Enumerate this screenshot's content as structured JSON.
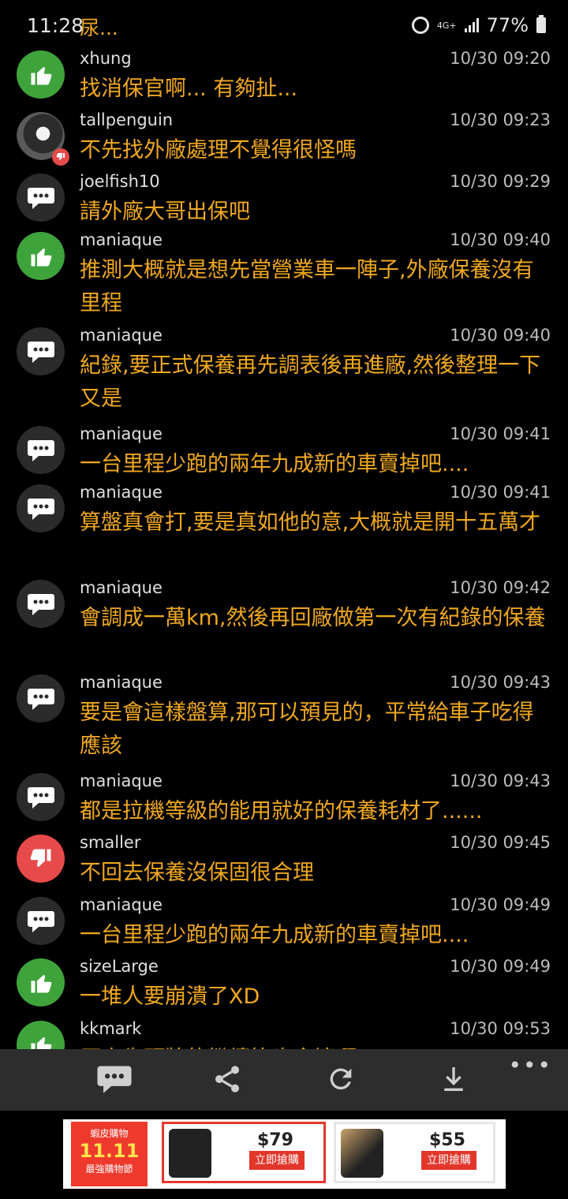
{
  "status": {
    "time": "11:28",
    "title_fragment": "尿...",
    "network": "4G+",
    "battery": "77%"
  },
  "comments": [
    {
      "user": "xhung",
      "time": "10/30 09:20",
      "text": "找消保官啊... 有夠扯...",
      "avatar": "thumbs-up-icon"
    },
    {
      "user": "tallpenguin",
      "time": "10/30 09:23",
      "text": "不先找外廠處理不覺得很怪嗎",
      "avatar": "photo"
    },
    {
      "user": "joelfish10",
      "time": "10/30 09:29",
      "text": "請外廠大哥出保吧",
      "avatar": "comment-icon"
    },
    {
      "user": "maniaque",
      "time": "10/30 09:40",
      "text": "推測大概就是想先當營業車一陣子,外廠保養沒有里程",
      "avatar": "thumbs-up-icon"
    },
    {
      "user": "maniaque",
      "time": "10/30 09:40",
      "text": "紀錄,要正式保養再先調表後再進廠,然後整理一下又是",
      "avatar": "comment-icon"
    },
    {
      "user": "maniaque",
      "time": "10/30 09:41",
      "text": "一台里程少跑的兩年九成新的車賣掉吧....",
      "avatar": "comment-icon"
    },
    {
      "user": "maniaque",
      "time": "10/30 09:41",
      "text": "算盤真會打,要是真如他的意,大概就是開十五萬才",
      "avatar": "comment-icon"
    },
    {
      "user": "maniaque",
      "time": "10/30 09:42",
      "text": "會調成一萬km,然後再回廠做第一次有紀錄的保養",
      "avatar": "comment-icon"
    },
    {
      "user": "maniaque",
      "time": "10/30 09:43",
      "text": "要是會這樣盤算,那可以預見的，平常給車子吃得應該",
      "avatar": "comment-icon"
    },
    {
      "user": "maniaque",
      "time": "10/30 09:43",
      "text": "都是拉機等級的能用就好的保養耗材了......",
      "avatar": "comment-icon"
    },
    {
      "user": "smaller",
      "time": "10/30 09:45",
      "text": "不回去保養沒保固很合理",
      "avatar": "thumbs-down-icon"
    },
    {
      "user": "maniaque",
      "time": "10/30 09:49",
      "text": "一台里程少跑的兩年九成新的車賣掉吧....",
      "avatar": "comment-icon"
    },
    {
      "user": "sizeLarge",
      "time": "10/30 09:49",
      "text": "一堆人要崩潰了XD",
      "avatar": "thumbs-up-icon"
    },
    {
      "user": "kkmark",
      "time": "10/30 09:53",
      "text": "原來先頭牌的繼續等也會壞啊",
      "avatar": "thumbs-up-icon"
    }
  ],
  "toolbar": {
    "items": [
      "comment-icon",
      "share-icon",
      "refresh-icon",
      "download-icon"
    ],
    "more": "•••"
  },
  "ad": {
    "logo_top": "蝦皮購物",
    "logo_big": "11.11",
    "logo_bottom": "最強購物節",
    "cards": [
      {
        "price": "$79",
        "cta": "立即搶購"
      },
      {
        "price": "$55",
        "cta": "立即搶購"
      }
    ]
  },
  "colors": {
    "accent_text": "#f0a820",
    "like": "#3fa33c",
    "dislike": "#e74a4a",
    "neutral": "#2b2b2b",
    "toolbar_bg": "#2d2d2d"
  }
}
